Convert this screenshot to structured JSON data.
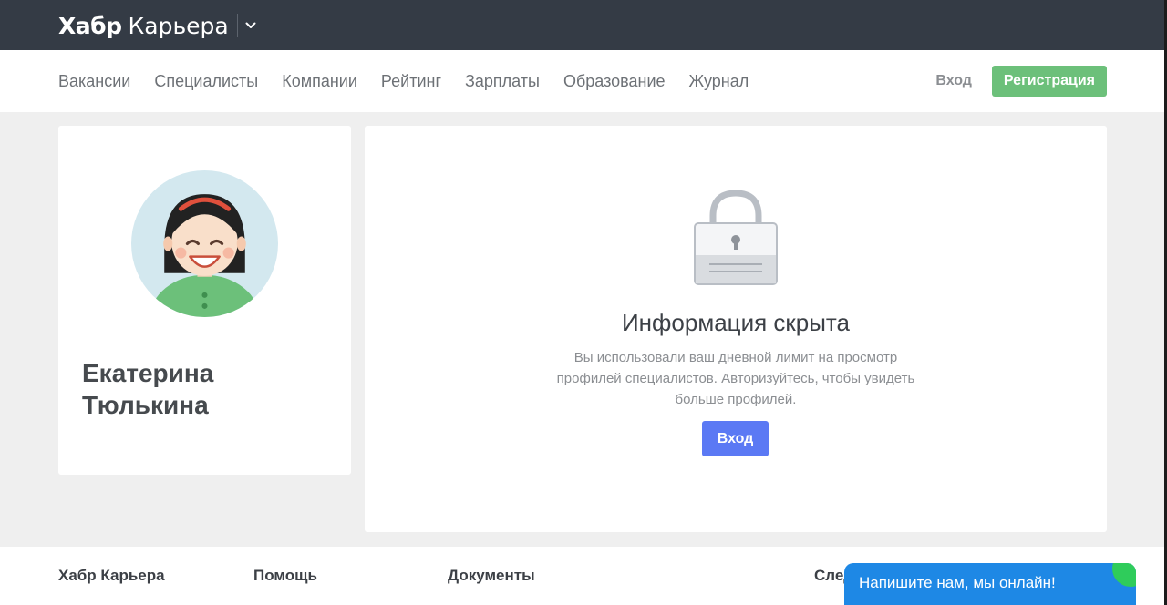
{
  "header": {
    "logo_strong": "Хабр",
    "logo_light": "Карьера"
  },
  "nav": {
    "links": [
      "Вакансии",
      "Специалисты",
      "Компании",
      "Рейтинг",
      "Зарплаты",
      "Образование",
      "Журнал"
    ],
    "login": "Вход",
    "register": "Регистрация"
  },
  "profile": {
    "name": "Екатерина Тюлькина"
  },
  "info": {
    "title": "Информация скрыта",
    "text": "Вы использовали ваш дневной лимит на просмотр профилей специалистов. Авторизуйтесь, чтобы увидеть больше профилей.",
    "button": "Вход"
  },
  "footer": {
    "columns": [
      "Хабр Карьера",
      "Помощь",
      "Документы",
      "След"
    ]
  },
  "chat": {
    "text": "Напишите нам, мы онлайн!"
  },
  "colors": {
    "topbar": "#343b45",
    "register": "#6cc07a",
    "login_button": "#5b79f4",
    "chat": "#1e88e5",
    "online_dot": "#2fcc5b"
  }
}
